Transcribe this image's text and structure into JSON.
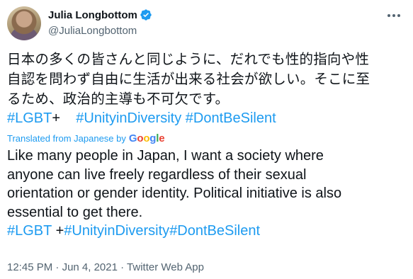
{
  "author": {
    "display_name": "Julia Longbottom",
    "handle": "@JuliaLongbottom",
    "verified": true,
    "verified_icon": "verified-badge-icon",
    "avatar_icon": "profile-photo"
  },
  "tweet": {
    "original_lines": [
      "日本の多くの皆さんと同じように、だれでも性的指向や性",
      "自認を問わず自由に生活が出来る社会が欲しい。そこに至",
      "るため、政治的主導も不可欠です。"
    ],
    "original_hashtags": {
      "tag1": "#LGBT",
      "plus": "+",
      "tag2": "#UnityinDiversity",
      "tag3": "#DontBeSilent"
    },
    "translation_label": "Translated from Japanese by",
    "translation_provider": {
      "G": "G",
      "o1": "o",
      "o2": "o",
      "g": "g",
      "l": "l",
      "e": "e"
    },
    "translated_lines": [
      "Like many people in Japan, I want a society where",
      "anyone can live freely regardless of their sexual",
      "orientation or gender identity. Political initiative is also",
      "essential to get there."
    ],
    "translated_hashtags": {
      "tag1": "#LGBT",
      "plus": "+",
      "tag2": "#UnityinDiversity",
      "tag3": "#DontBeSilent"
    }
  },
  "meta": {
    "time": "12:45 PM",
    "separator": "·",
    "date": "Jun 4, 2021",
    "source": "Twitter Web App"
  },
  "colors": {
    "link": "#1d9bf0",
    "text": "#0f1419",
    "secondary": "#536471"
  },
  "icons": {
    "more": "more-options-icon"
  }
}
